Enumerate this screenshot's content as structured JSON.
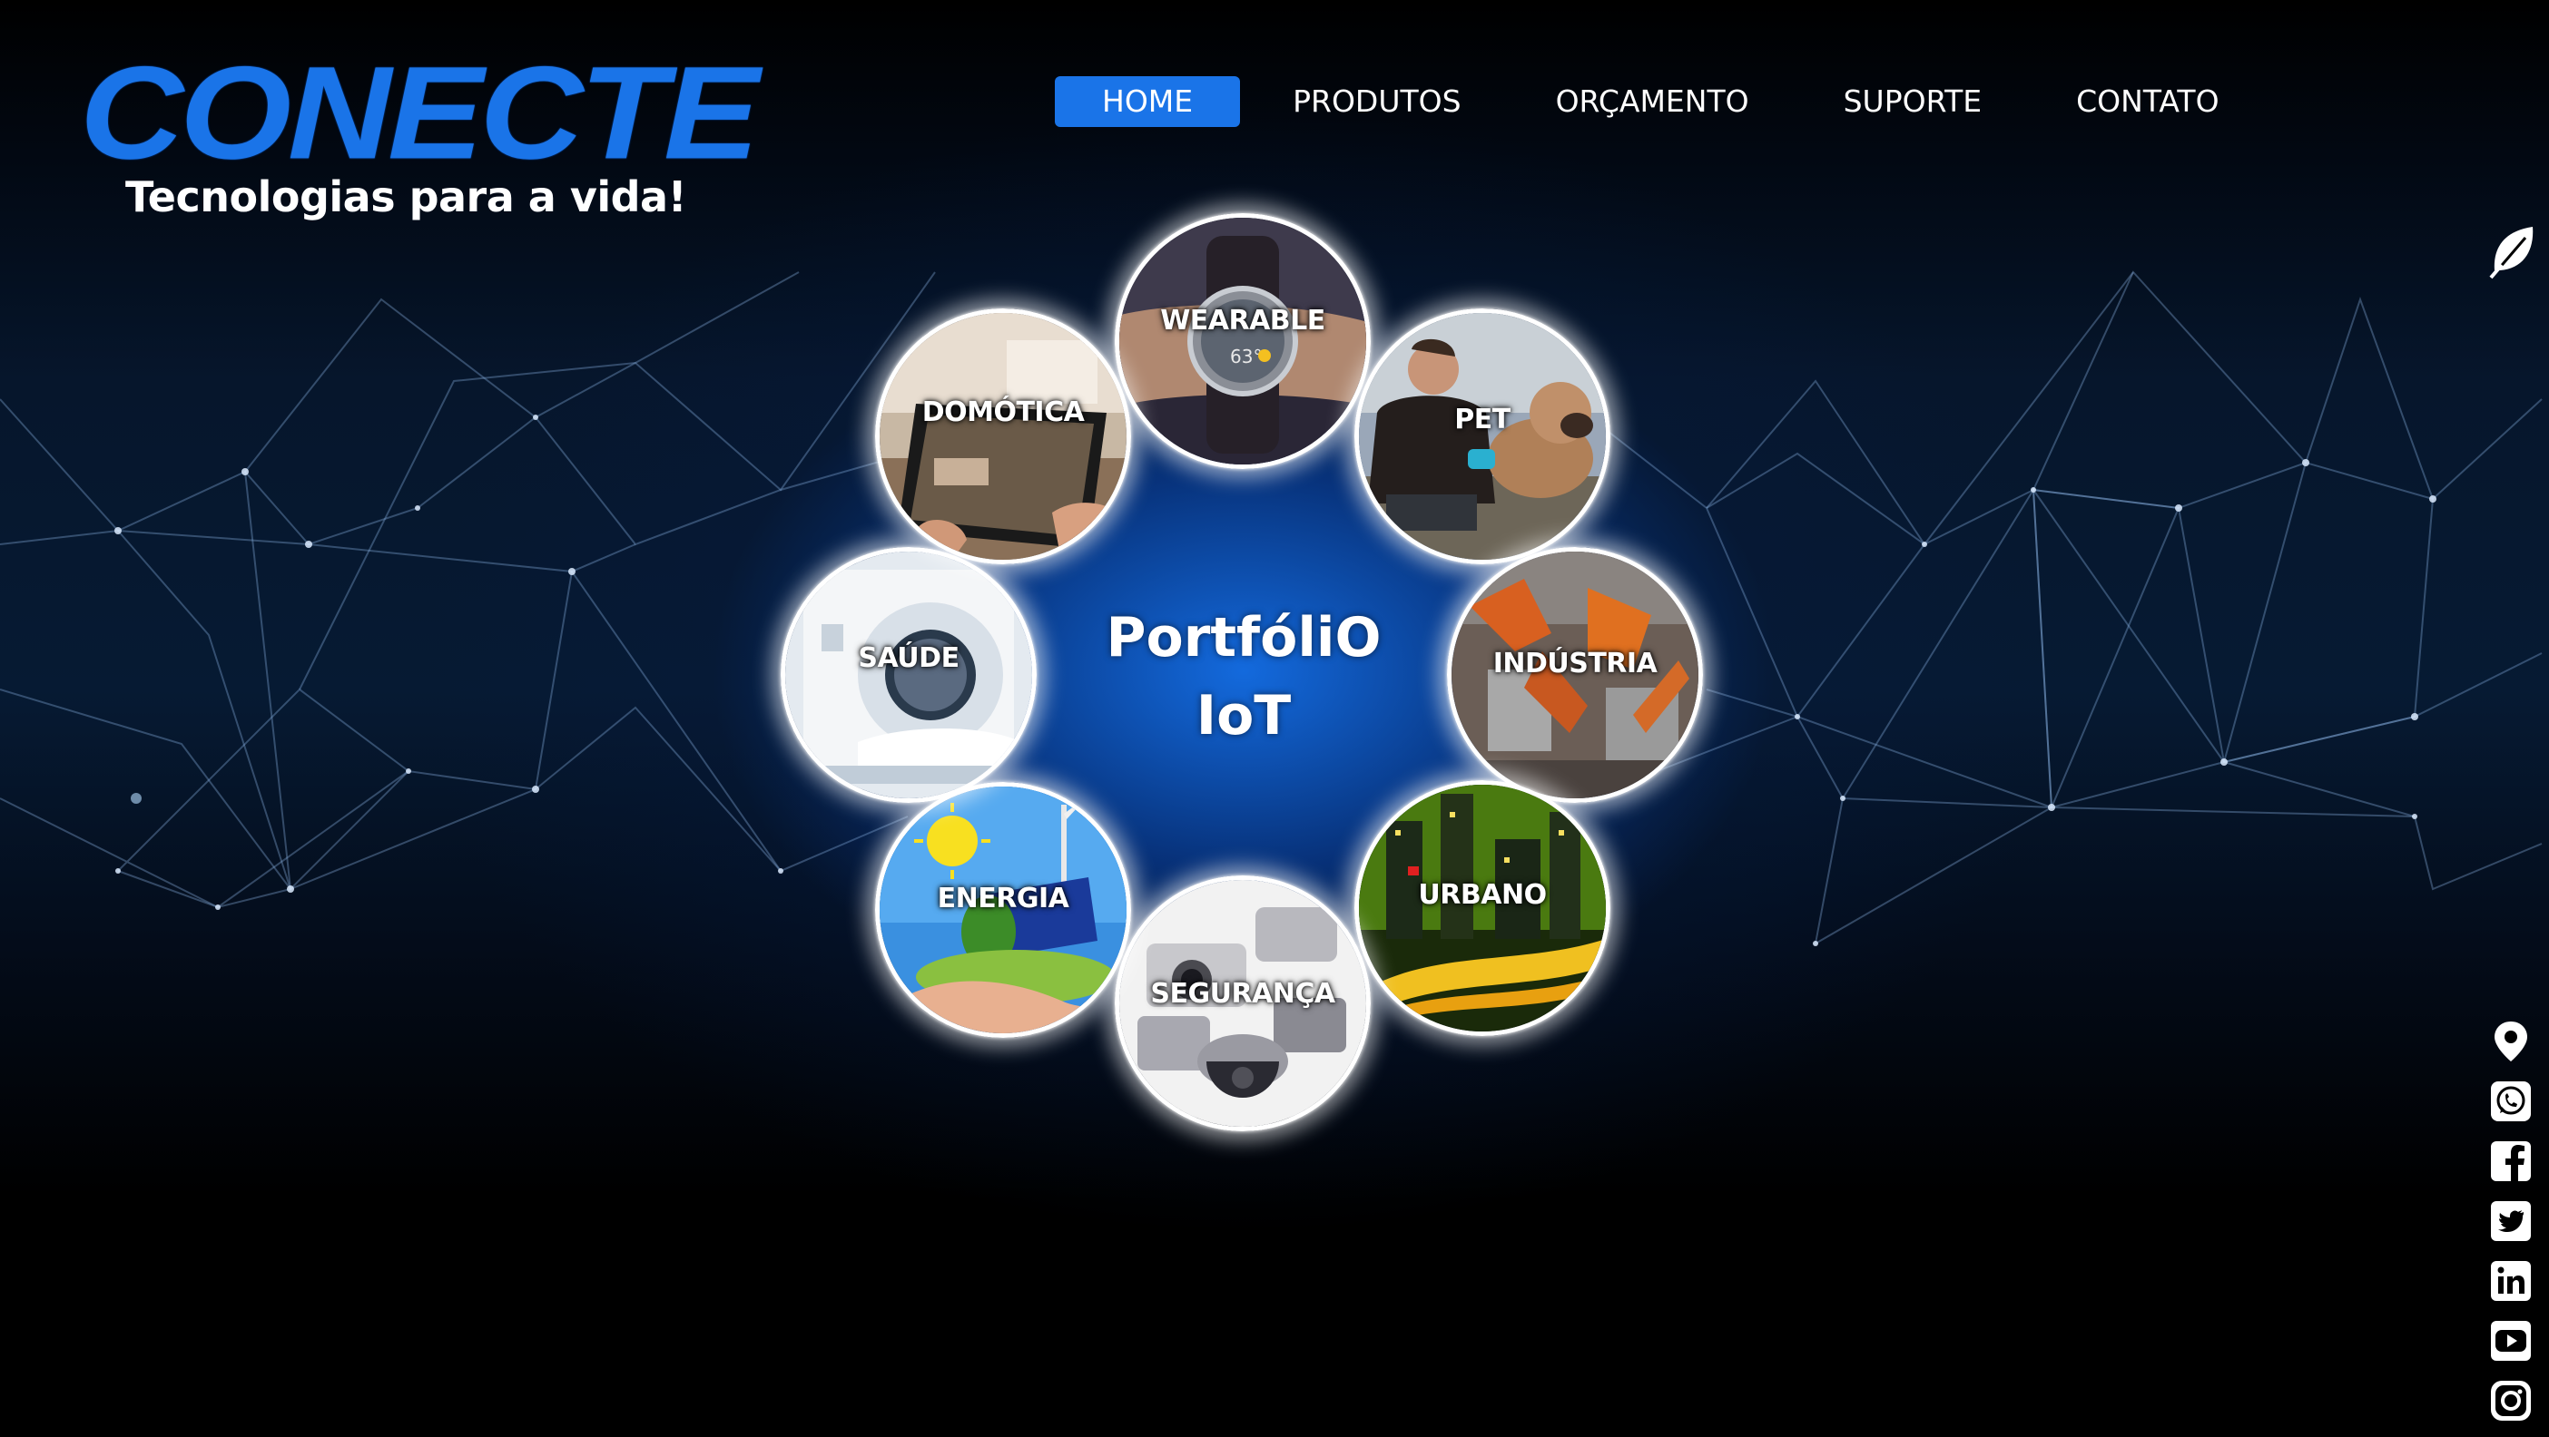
{
  "logo": {
    "wordmark": "CONECTE",
    "tagline": "Tecnologias para a vida!"
  },
  "nav": {
    "items": [
      "HOME",
      "PRODUTOS",
      "ORÇAMENTO",
      "SUPORTE",
      "CONTATO"
    ],
    "active": "HOME"
  },
  "portfolio": {
    "title_line1": "PortfóliO",
    "title_line2": "IoT",
    "items": [
      "WEARABLE",
      "PET",
      "INDÚSTRIA",
      "URBANO",
      "SEGURANÇA",
      "ENERGIA",
      "SAÚDE",
      "DOMÓTICA"
    ]
  },
  "side_icons": [
    "leaf-icon"
  ],
  "social_icons": [
    "location-pin-icon",
    "whatsapp-icon",
    "facebook-icon",
    "twitter-icon",
    "linkedin-icon",
    "youtube-icon",
    "instagram-icon"
  ],
  "colors": {
    "brand_blue": "#1a74e8",
    "background": "#000000",
    "text": "#ffffff"
  }
}
